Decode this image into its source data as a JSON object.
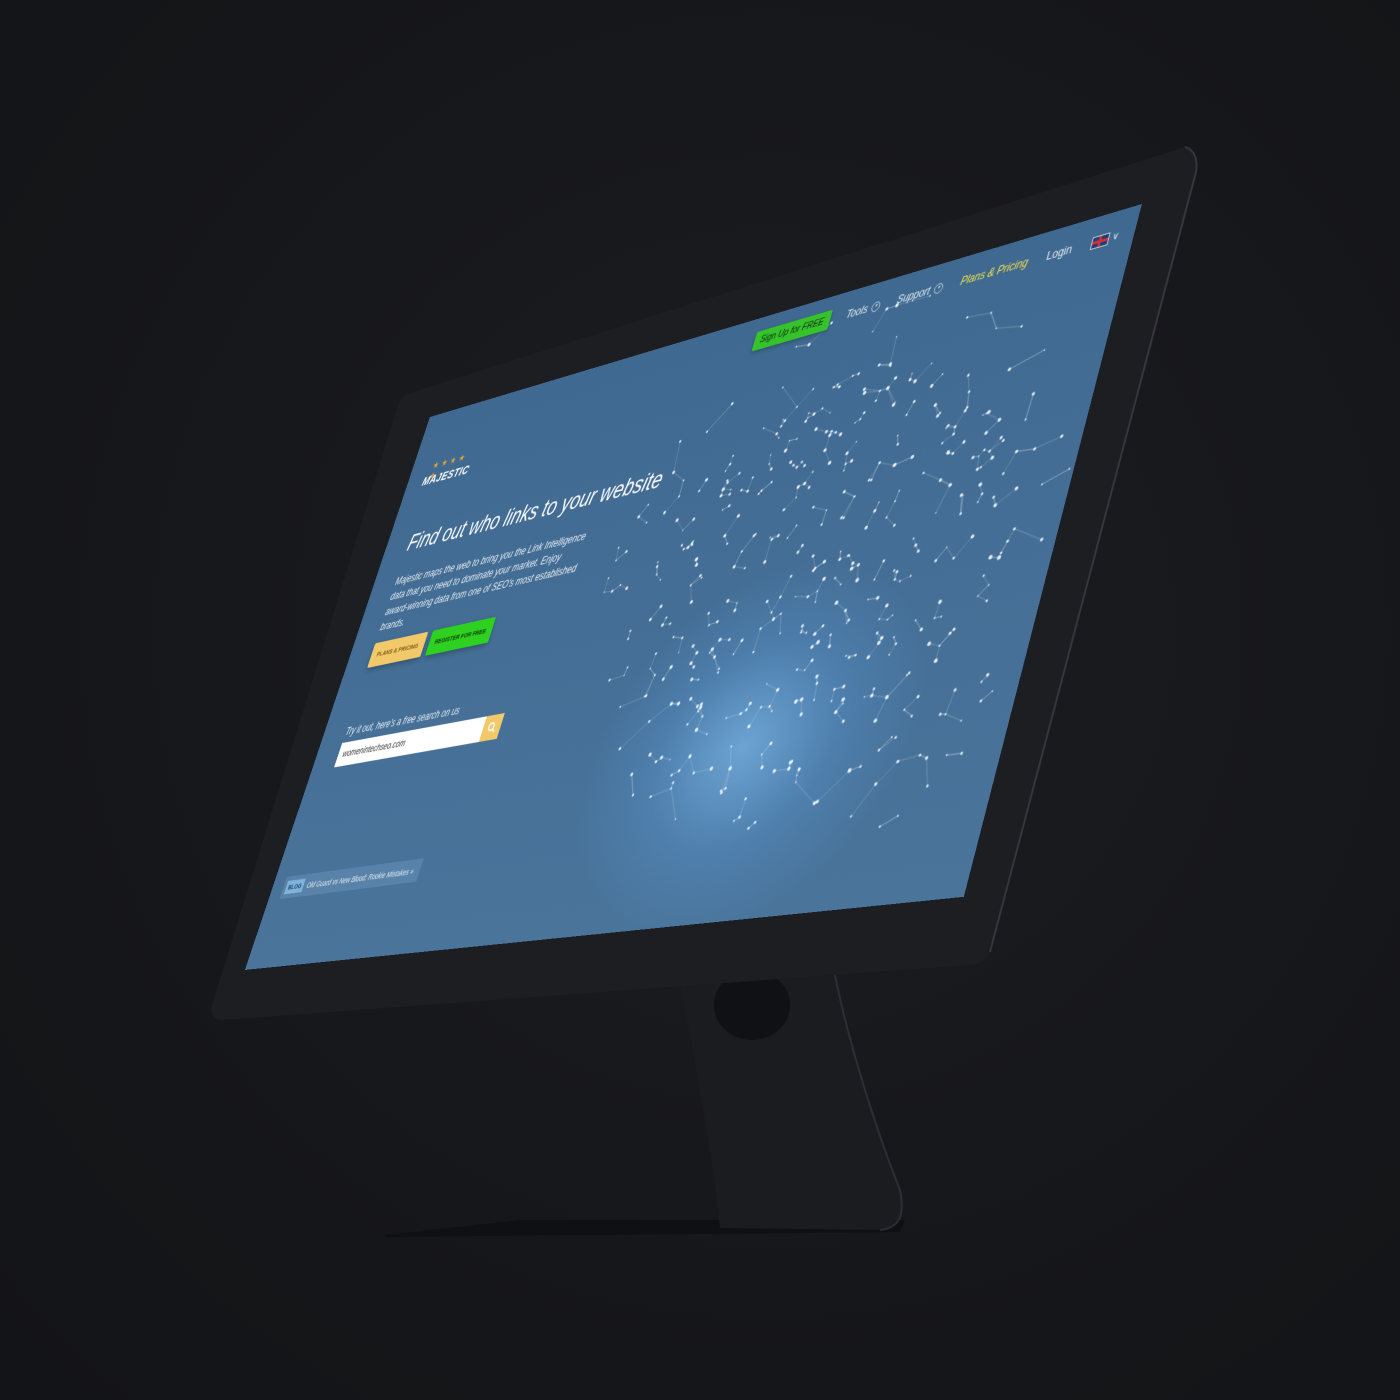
{
  "brand": {
    "name": "MAJESTIC",
    "stars": "★ ★ ★ ★ ★",
    "logo_star_color": "#e8a23a"
  },
  "nav": {
    "signup_label": "Sign Up for FREE",
    "tools_label": "Tools",
    "support_label": "Support",
    "pricing_label": "Plans & Pricing",
    "login_label": "Login",
    "language": "en-GB",
    "chevron_glyph": "▾",
    "lang_chevron_glyph": "∨"
  },
  "hero": {
    "headline": "Find out who links to your website",
    "intro": "Majestic maps the web to bring you the Link Intelligence data that you need to dominate your market. Enjoy award-winning data from one of SEO's most established brands.",
    "cta_pricing": "PLANS & PRICING",
    "cta_register": "REGISTER FOR FREE"
  },
  "search": {
    "label": "Try it out, here's a free search on us",
    "value": "womenintechseo.com",
    "icon": "search-icon"
  },
  "blog": {
    "badge": "BLOG",
    "text": "Old Guard vs New Blood: Rookie Mistakes »"
  },
  "colors": {
    "page_bg": "#16171b",
    "screen_bg": "#436d94",
    "signup_green": "#35c22a",
    "register_green": "#2ed120",
    "pricing_yellow": "#f2c96a",
    "nav_pricing_yellow": "#f3e24a"
  }
}
